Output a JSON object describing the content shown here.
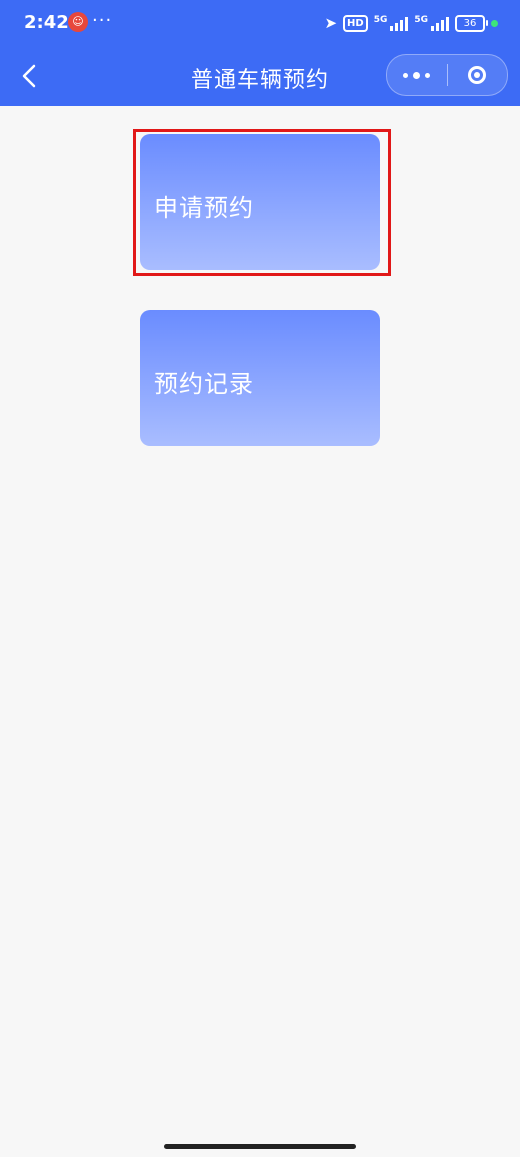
{
  "status_bar": {
    "time": "2:42",
    "more": "···",
    "hd": "HD",
    "network1": "5G",
    "network2": "5G",
    "battery": "36"
  },
  "navbar": {
    "title": "普通车辆预约"
  },
  "cards": {
    "apply_label": "申请预约",
    "records_label": "预约记录"
  },
  "colors": {
    "header": "#3d6bf5",
    "card_top": "#6a8cff",
    "card_bottom": "#a9bdff",
    "highlight": "#e11818",
    "background": "#f7f7f7"
  }
}
